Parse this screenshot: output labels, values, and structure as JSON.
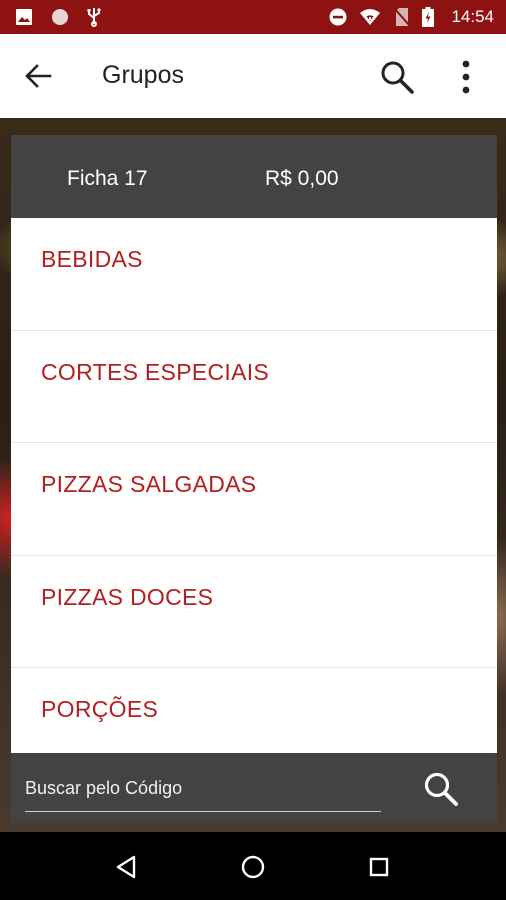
{
  "status_bar": {
    "time": "14:54",
    "icons": [
      "image-icon",
      "circle-icon",
      "usb-icon",
      "dnd-icon",
      "wifi-icon",
      "no-sim-icon",
      "battery-icon"
    ],
    "color": "#8e1212"
  },
  "app_bar": {
    "title": "Grupos",
    "back_icon": "arrow-left-icon",
    "search_icon": "search-icon",
    "more_icon": "more-vert-icon"
  },
  "order": {
    "ficha": "Ficha 17",
    "total": "R$ 0,00"
  },
  "groups": [
    {
      "label": "BEBIDAS"
    },
    {
      "label": "CORTES ESPECIAIS"
    },
    {
      "label": "PIZZAS SALGADAS"
    },
    {
      "label": "PIZZAS DOCES"
    },
    {
      "label": "PORÇÕES"
    }
  ],
  "code_search": {
    "placeholder": "Buscar pelo Código",
    "icon": "search-icon"
  },
  "nav": {
    "icons": [
      "back-triangle-icon",
      "home-circle-icon",
      "recents-square-icon"
    ]
  },
  "colors": {
    "accent": "#b22020",
    "status_bar": "#8e1212",
    "dark_bar": "#434343"
  }
}
